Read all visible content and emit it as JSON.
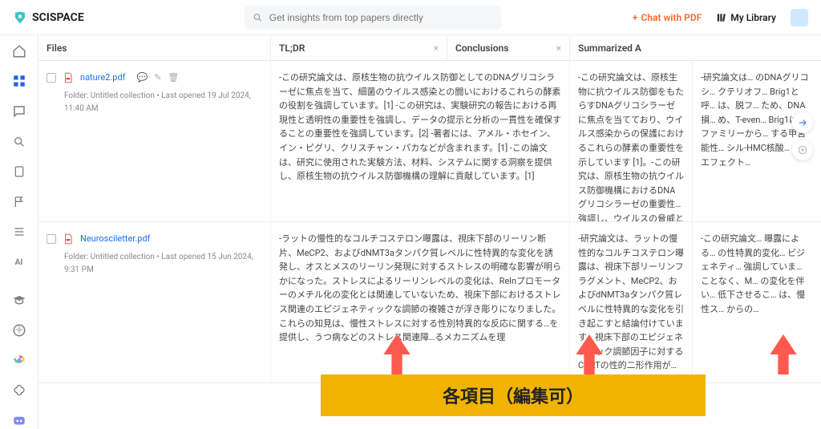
{
  "brand": "SCISPACE",
  "search": {
    "placeholder": "Get insights from top papers directly"
  },
  "topbar": {
    "chat": "Chat with PDF",
    "library": "My Library"
  },
  "columns": {
    "files": "Files",
    "tldr": "TL;DR",
    "conclusions": "Conclusions",
    "summary": "Summarized A"
  },
  "rows": [
    {
      "file": "nature2.pdf",
      "folder": "Folder: Untitled collection",
      "opened": "Last opened 19 Jul 2024, 11:40 AM",
      "tldr": "-この研究論文は、原核生物の抗ウイルス防御としてのDNAグリコシラーゼに焦点を当て、細菌のウイルス感染との闘いにおけるこれらの酵素の役割を強調しています。[1] -この研究は、実験研究の報告における再現性と透明性の重要性を強調し、データの提示と分析の一貫性を確保することの重要性を強調しています。[2] -著者には、アメル・ホセイン、イン・ピグリ、クリスチャン・パカなどが含まれます。[1] -この論文は、研究に使用された実験方法、材料、システムに関する洞察を提供し、原核生物の抗ウイルス防御機構の理解に貢献しています。[1]",
      "conclusions": "-この研究論文は、原核生物に抗ウイルス防御をもたらすDNAグリコシラーゼに焦点を当てており、ウイルス感染からの保護におけるこれらの酵素の重要性を示しています [1]。-この研究は、原核生物の抗ウイルス防御機構におけるDNAグリコシラーゼの重要性を強調し、ウイルスの脅威との闘いにおけるDNAグリコシラーゼの役割に光を当てています [1]。-全体として、この論文は、DNAグリコシラーゼが原核生物の抗ウイルス防御に重要な役割を果たしていると結論づけ、ウイルス感染に対する免疫応答において重要な役割を果たす可能性を浮き彫りにしています [1]。",
      "summary": "-研究論文は… のDNAグリコシ… クテリオフ… Brig1と呼… は、脱フ… ため、DNA損… め、T-even… Brig1は、ファミリーから… する甲宮能性… シル-HMC核酸… ルスエフェクト…"
    },
    {
      "file": "Neurosciletter.pdf",
      "folder": "Folder: Untitled collection",
      "opened": "Last opened 15 Jun 2024, 9:31 PM",
      "tldr": "-ラットの慢性的なコルチコステロン曝露は、視床下部のリーリン断片、MeCP2、およびdNMT3aタンパク質レベルに性特異的な変化を誘発し、オスとメスのリーリン発現に対するストレスの明確な影響が明らかになった。ストレスによるリーリンレベルの変化は、Relnプロモーターのメチル化の変化とは関連していないため、視床下部におけるストレス関連のエピジェネティックな調節の複雑さが浮き彫りになりました。これらの知見は、慢性ストレスに対する性別特異的な反応に関する…を提供し、うつ病などのストレス関連障…るメカニズムを理",
      "conclusions": "-研究論文は、ラットの慢性的なコルチコステロン曝露は、視床下部リーリンフラグメント、MeCP2、およびdNMT3aタンパク質レベルに性特異的な変化を引き起こすと結論付けています。視床下部のエピジェネティック調節因子に対するCORTの性的二形作用が観察され、リーリンタンパク質断片の変化が認められたが、Relnプロモーターのメチル化は認められなかった。これらの知見は、慢性ストレスがリーリンレベルに及ぼす性特異的影響の根底にある明確なメカニズムへの洞…し、うつ病などのストレス関連障害の新…発する上でこれら",
      "summary": "-この研究論文… 曝露による… の性特異的変化… ビジェネティ… 強調していま… ことなく、M… の変化を伴い… 低下させるこ… は、慢性ス… からの…"
    }
  ],
  "annotation": {
    "banner": "各項目（編集可）"
  }
}
